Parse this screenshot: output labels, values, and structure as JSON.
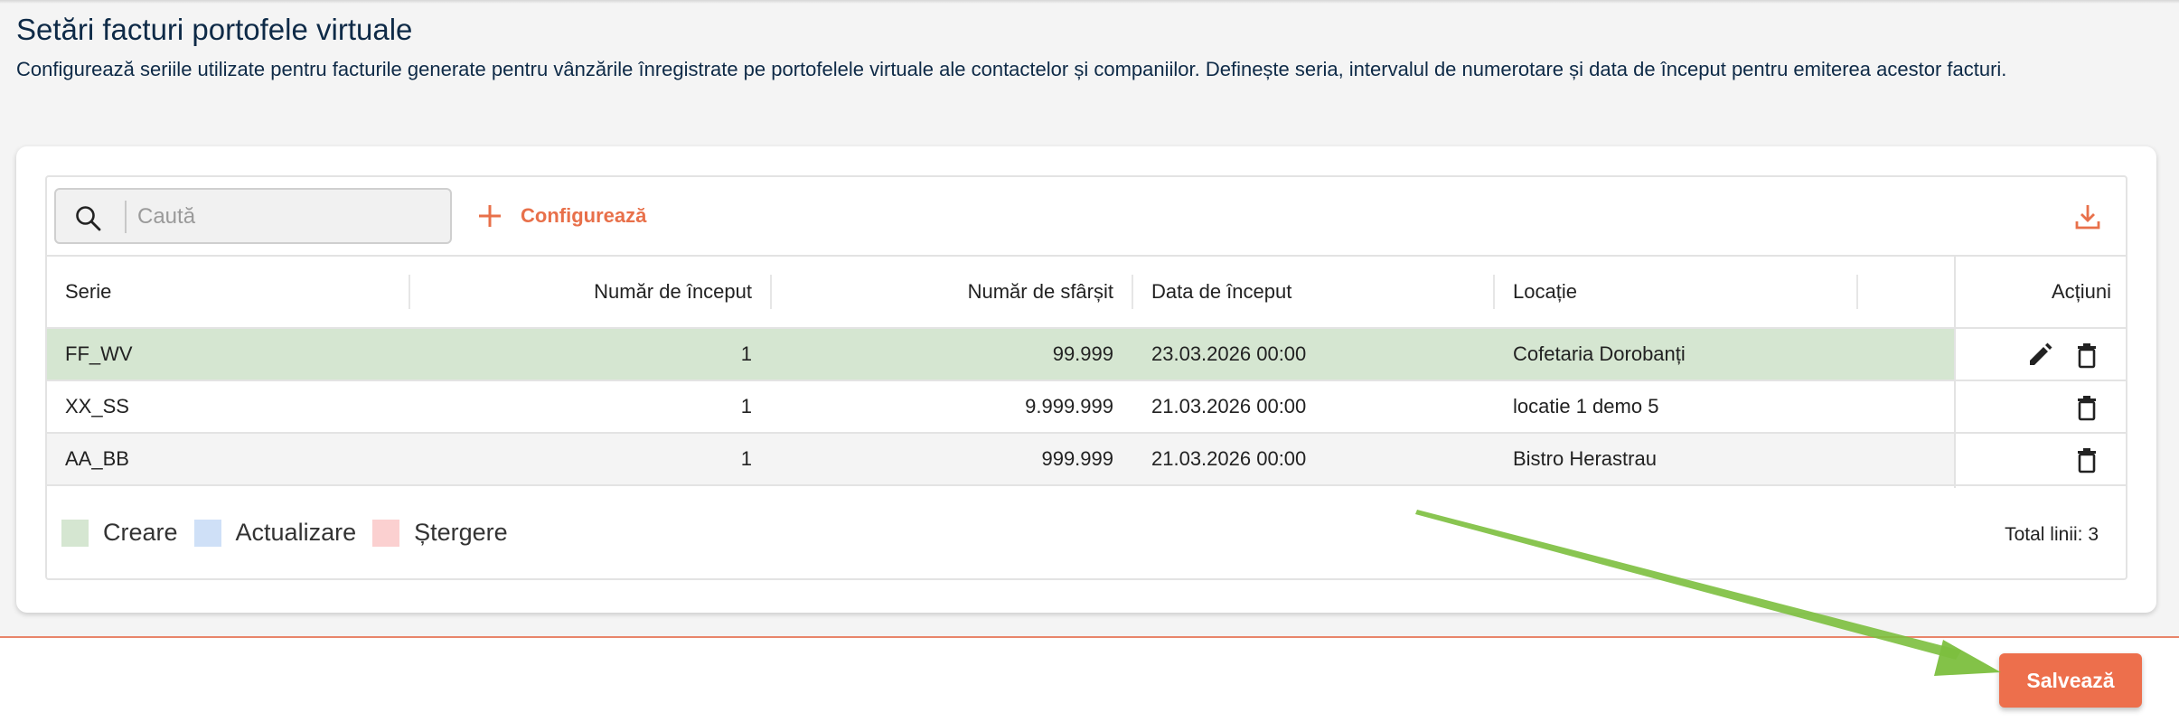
{
  "page": {
    "title": "Setări facturi portofele virtuale",
    "description": "Configurează seriile utilizate pentru facturile generate pentru vânzările înregistrate pe portofelele virtuale ale contactelor și companiilor. Definește seria, intervalul de numerotare și data de început pentru emiterea acestor facturi."
  },
  "toolbar": {
    "search_placeholder": "Caută",
    "search_icon": "search-icon",
    "configure_label": "Configurează",
    "configure_icon": "plus-icon",
    "download_icon": "download-icon"
  },
  "table": {
    "columns": [
      "Serie",
      "Număr de început",
      "Număr de sfârșit",
      "Data de început",
      "Locație",
      "Acțiuni"
    ],
    "rows": [
      {
        "serie": "FF_WV",
        "start": "1",
        "end": "99.999",
        "date": "23.03.2026 00:00",
        "location": "Cofetaria Dorobanți",
        "status": "creare",
        "actions": [
          "edit-icon",
          "delete-icon"
        ]
      },
      {
        "serie": "XX_SS",
        "start": "1",
        "end": "9.999.999",
        "date": "21.03.2026 00:00",
        "location": "locatie 1 demo 5",
        "status": "none",
        "actions": [
          "delete-icon"
        ]
      },
      {
        "serie": "AA_BB",
        "start": "1",
        "end": "999.999",
        "date": "21.03.2026 00:00",
        "location": "Bistro Herastrau",
        "status": "none",
        "actions": [
          "delete-icon"
        ]
      }
    ]
  },
  "legend": {
    "items": [
      {
        "label": "Creare",
        "color": "#d5e6d1"
      },
      {
        "label": "Actualizare",
        "color": "#cfe0f7"
      },
      {
        "label": "Ștergere",
        "color": "#fbd0d0"
      }
    ]
  },
  "footer": {
    "total_label": "Total linii: 3",
    "save_label": "Salvează"
  },
  "colors": {
    "accent": "#ed6f4c",
    "title": "#0e2a47",
    "row_created": "#d5e6d1",
    "row_alt": "#f4f4f4",
    "annotation_arrow": "#7cbf3e"
  }
}
